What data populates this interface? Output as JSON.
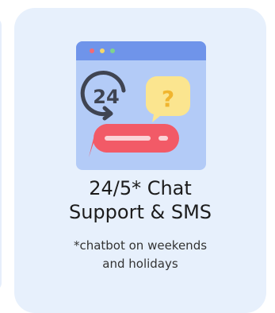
{
  "card": {
    "icon": "24-hour-chat-support-icon",
    "title_line1": "24/5* Chat",
    "title_line2": "Support & SMS",
    "note_line1": "*chatbot on weekends",
    "note_line2": "and holidays",
    "illustration_text": {
      "clock_number": "24",
      "question_mark": "?"
    }
  },
  "colors": {
    "card_background": "#e7f0fc",
    "window_body": "#b3cbf7",
    "window_titlebar": "#6f94ea",
    "dot_red": "#f36b74",
    "dot_yellow": "#f6d86a",
    "dot_green": "#7fd38d",
    "clock_stroke": "#3f4452",
    "question_bubble": "#fbe58f",
    "chat_bubble": "#f25a67"
  }
}
